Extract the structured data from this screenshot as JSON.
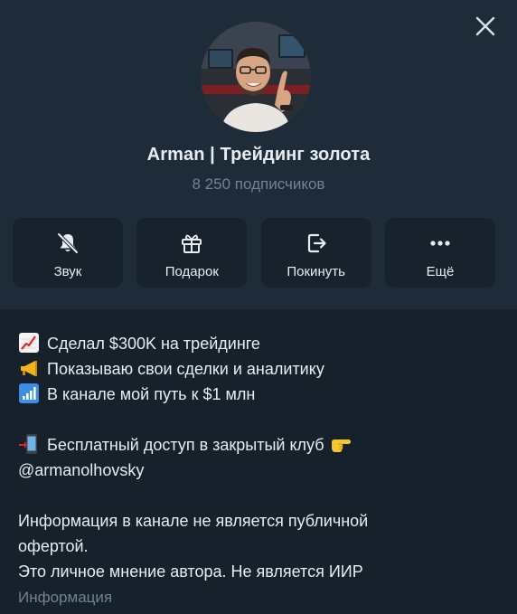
{
  "channel": {
    "title": "Arman | Трейдинг золота",
    "subscribers": "8 250 подписчиков"
  },
  "actions": [
    {
      "label": "Звук",
      "icon": "bell-muted-icon"
    },
    {
      "label": "Подарок",
      "icon": "gift-icon"
    },
    {
      "label": "Покинуть",
      "icon": "leave-icon"
    },
    {
      "label": "Ещё",
      "icon": "more-dots-icon"
    }
  ],
  "description": {
    "line1": "Сделал $300K на трейдинге",
    "line2": "Показываю свои сделки и аналитику",
    "line3": "В канале мой путь к $1 млн",
    "line4": "Бесплатный доступ в закрытый клуб",
    "line5": "@armanolhovsky",
    "line6": "Информация в канале не является публичной",
    "line7": "офертой.",
    "line8": "Это личное мнение автора. Не является ИИР",
    "emojis": [
      "chart-increasing-emoji",
      "megaphone-emoji",
      "signal-bars-emoji",
      "mobile-arrow-emoji",
      "pointing-right-emoji"
    ]
  },
  "info_label": "Информация",
  "colors": {
    "header_bg": "#1e2c3a",
    "content_bg": "#17212b",
    "button_bg": "#17222d",
    "text_primary": "#e8edf2",
    "text_secondary": "#6f8396"
  }
}
